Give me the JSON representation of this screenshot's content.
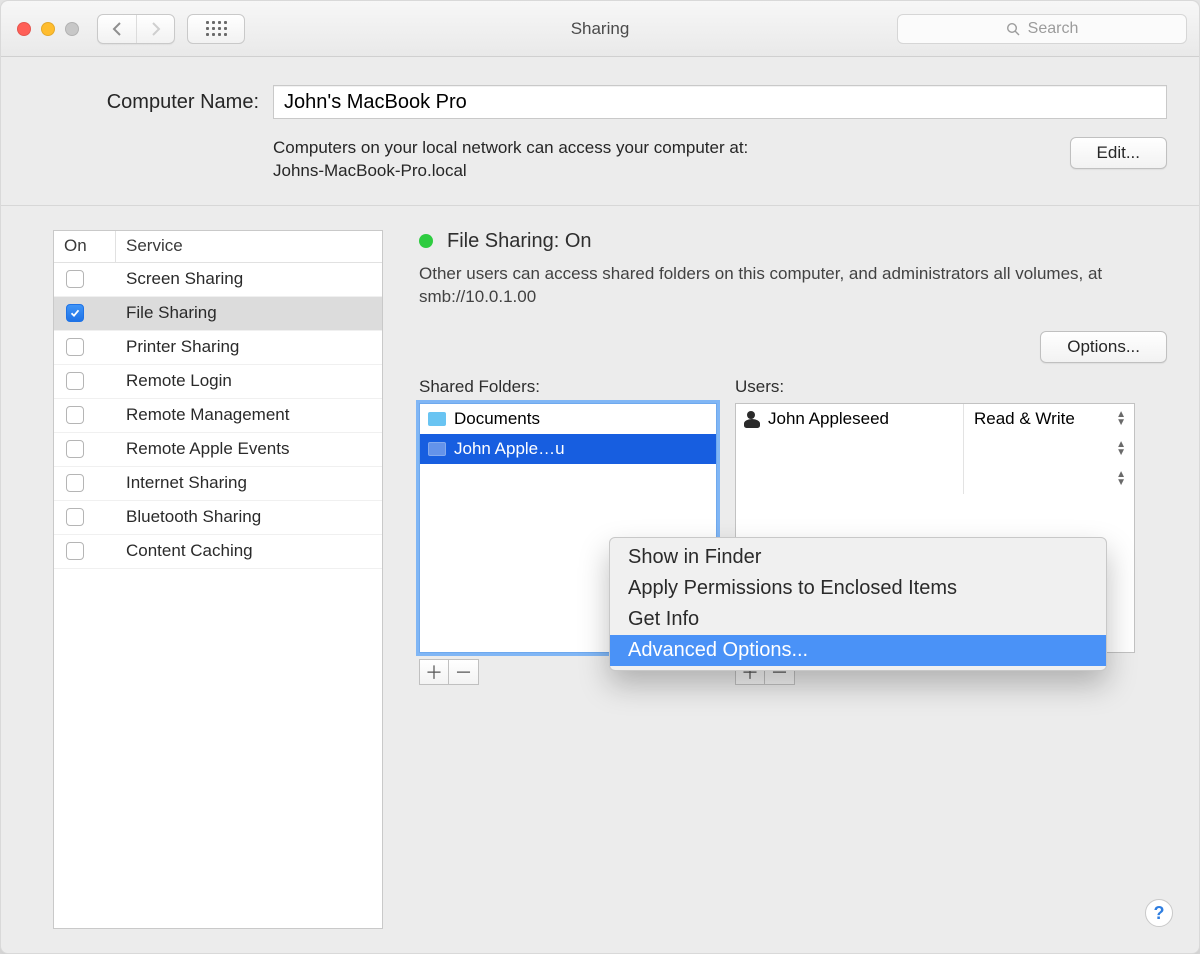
{
  "window": {
    "title": "Sharing",
    "search_placeholder": "Search"
  },
  "computer": {
    "label": "Computer Name:",
    "name": "John's MacBook Pro",
    "info_line1": "Computers on your local network can access your computer at:",
    "info_line2": "Johns-MacBook-Pro.local",
    "edit_button": "Edit..."
  },
  "service_table": {
    "col_on": "On",
    "col_service": "Service",
    "rows": [
      {
        "on": false,
        "name": "Screen Sharing",
        "selected": false
      },
      {
        "on": true,
        "name": "File Sharing",
        "selected": true
      },
      {
        "on": false,
        "name": "Printer Sharing",
        "selected": false
      },
      {
        "on": false,
        "name": "Remote Login",
        "selected": false
      },
      {
        "on": false,
        "name": "Remote Management",
        "selected": false
      },
      {
        "on": false,
        "name": "Remote Apple Events",
        "selected": false
      },
      {
        "on": false,
        "name": "Internet Sharing",
        "selected": false
      },
      {
        "on": false,
        "name": "Bluetooth Sharing",
        "selected": false
      },
      {
        "on": false,
        "name": "Content Caching",
        "selected": false
      }
    ]
  },
  "status": {
    "title": "File Sharing: On",
    "description": "Other users can access shared folders on this computer, and administrators all volumes, at smb://10.0.1.00",
    "options_button": "Options..."
  },
  "shared_folders": {
    "label": "Shared Folders:",
    "items": [
      {
        "name": "Documents",
        "selected": false
      },
      {
        "name": "John Apple…u",
        "selected": true
      }
    ]
  },
  "users": {
    "label": "Users:",
    "items": [
      {
        "name": "John Appleseed",
        "permission": "Read & Write"
      }
    ]
  },
  "context_menu": {
    "items": [
      {
        "label": "Show in Finder",
        "selected": false
      },
      {
        "label": "Apply Permissions to Enclosed Items",
        "selected": false
      },
      {
        "label": "Get Info",
        "selected": false
      },
      {
        "label": "Advanced Options...",
        "selected": true
      }
    ]
  },
  "buttons": {
    "help": "?"
  }
}
